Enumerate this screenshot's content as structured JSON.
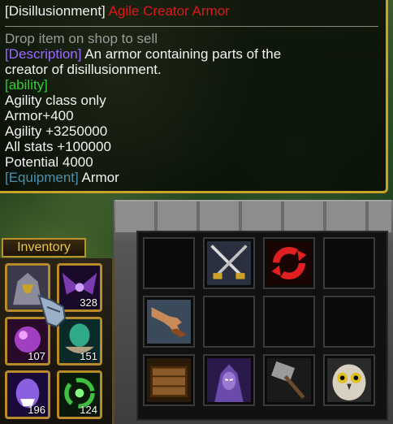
{
  "tooltip": {
    "title_prefix": "[Disillusionment]",
    "title_item": "Agile Creator Armor",
    "hint": "Drop item on shop to sell",
    "desc_tag": "[Description]",
    "desc_line1": " An armor containing parts of the",
    "desc_line2": "creator of disillusionment.",
    "ability_tag": "[ability]",
    "stats": [
      "Agility class only",
      "Armor+400",
      "Agility +3250000",
      "All stats +100000",
      "Potential 4000"
    ],
    "equip_tag": "[Equipment]",
    "equip_value": " Armor"
  },
  "inventory": {
    "label": "Inventory",
    "slots": [
      {
        "icon": "armored-warrior-icon",
        "count": ""
      },
      {
        "icon": "dark-wings-icon",
        "count": "328"
      },
      {
        "icon": "purple-orb-icon",
        "count": "107"
      },
      {
        "icon": "green-potion-bowl-icon",
        "count": "151"
      },
      {
        "icon": "demon-face-icon",
        "count": "196"
      },
      {
        "icon": "green-swirl-icon",
        "count": "124"
      }
    ]
  },
  "stash": {
    "slots": [
      {
        "icon": ""
      },
      {
        "icon": "crossed-swords-icon"
      },
      {
        "icon": "red-refresh-icon"
      },
      {
        "icon": ""
      },
      {
        "icon": "reaching-hand-icon"
      },
      {
        "icon": ""
      },
      {
        "icon": ""
      },
      {
        "icon": ""
      },
      {
        "icon": "wooden-crate-icon"
      },
      {
        "icon": "night-elf-icon"
      },
      {
        "icon": "stone-hammer-icon"
      },
      {
        "icon": "owl-icon"
      }
    ]
  },
  "colors": {
    "title_red": "#e01818",
    "desc_purple": "#9b6bff",
    "ability_green": "#30d030",
    "equip_teal": "#4a8fb0",
    "gold_border": "#b88a2a"
  }
}
